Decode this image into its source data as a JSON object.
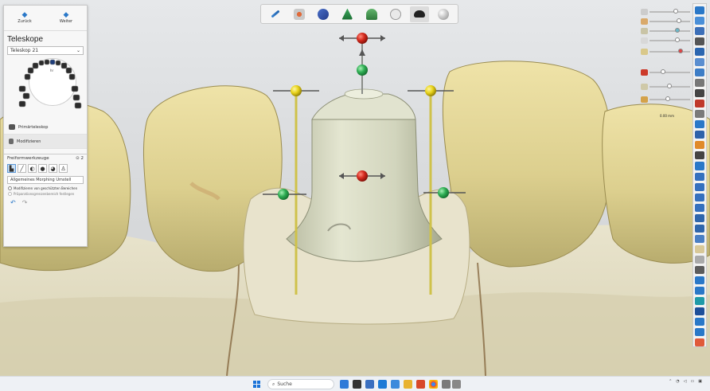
{
  "colors": {
    "accent": "#2a78c8",
    "handle_red": "#d42a1e",
    "handle_green": "#2fae54",
    "handle_yellow": "#e8d31a",
    "tooth": "#e6d9a3",
    "gingiva": "#e9e3c9",
    "telescope_crown": "#d9dcc4"
  },
  "nav": {
    "back_label": "Zurück",
    "next_label": "Weiter"
  },
  "panel": {
    "title": "Teleskope",
    "selected_telescope": "Teleskop 21",
    "preview_label": "hr",
    "modes": [
      {
        "label": "Primärteleskop",
        "icon": "telescope-icon"
      },
      {
        "label": "Modifizieren",
        "icon": "modify-icon"
      }
    ],
    "freeform_tools_label": "Freiformwerkzeuge",
    "freeform_tools_count": "2",
    "morphing_dropdown": "Allgemeines Morphing Umstell",
    "checkbox_1": "Modifizieren von geschützten Bereichen",
    "checkbox_2": "Präparationsgrenzenbereich festlegen",
    "tools": [
      "pin-icon",
      "pen-icon",
      "smooth-icon",
      "drop-icon",
      "paint-icon",
      "stamp-icon"
    ]
  },
  "toolbar": {
    "buttons": [
      {
        "icon": "wrench-icon",
        "active": false
      },
      {
        "icon": "jaw-icon",
        "active": false
      },
      {
        "icon": "bite-icon",
        "active": false
      },
      {
        "icon": "model-icon",
        "active": false
      },
      {
        "icon": "arch-icon",
        "active": false
      },
      {
        "icon": "tooth-icon",
        "active": false
      },
      {
        "icon": "crown-icon",
        "active": true
      },
      {
        "icon": "sphere-icon",
        "active": false
      }
    ]
  },
  "right_controls": {
    "distance_label": "0.00 mm"
  },
  "taskbar": {
    "search_label": "Suche",
    "weather": "",
    "apps": [
      "widgets-icon",
      "explorer-icon",
      "chrome-icon",
      "edge-icon",
      "files-icon",
      "dental-app-icon",
      "mail-icon",
      "store-icon",
      "settings-icon"
    ]
  }
}
